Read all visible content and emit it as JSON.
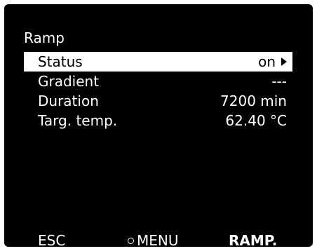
{
  "screen": {
    "title": "Ramp",
    "rows": [
      {
        "label": "Status",
        "value": "on"
      },
      {
        "label": "Gradient",
        "value": "---"
      },
      {
        "label": "Duration",
        "value": "7200 min"
      },
      {
        "label": "Targ. temp.",
        "value": "62.40 °C"
      }
    ],
    "selected_row": "Status"
  },
  "softkeys": {
    "left": "ESC",
    "middle": "MENU",
    "right": "RAMP."
  },
  "colors": {
    "background": "#000000",
    "text": "#ffffff",
    "highlight": "#ffffff"
  }
}
